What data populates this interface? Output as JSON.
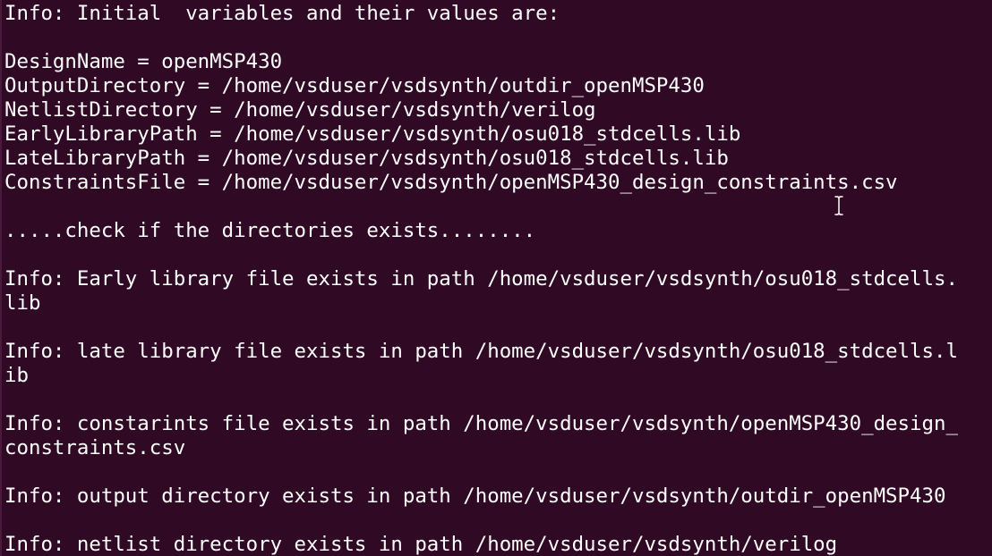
{
  "terminal": {
    "background": "#300a24",
    "foreground": "#ffffff",
    "lines": [
      "Info: Initial  variables and their values are:",
      "",
      "DesignName = openMSP430",
      "OutputDirectory = /home/vsduser/vsdsynth/outdir_openMSP430",
      "NetlistDirectory = /home/vsduser/vsdsynth/verilog",
      "EarlyLibraryPath = /home/vsduser/vsdsynth/osu018_stdcells.lib",
      "LateLibraryPath = /home/vsduser/vsdsynth/osu018_stdcells.lib",
      "ConstraintsFile = /home/vsduser/vsdsynth/openMSP430_design_constraints.csv",
      "",
      ".....check if the directories exists........",
      "",
      "Info: Early library file exists in path /home/vsduser/vsdsynth/osu018_stdcells.",
      "lib",
      "",
      "Info: late library file exists in path /home/vsduser/vsdsynth/osu018_stdcells.l",
      "ib",
      "",
      "Info: constarints file exists in path /home/vsduser/vsdsynth/openMSP430_design_",
      "constraints.csv",
      "",
      "Info: output directory exists in path /home/vsduser/vsdsynth/outdir_openMSP430",
      "",
      "Info: netlist directory exists in path /home/vsduser/vsdsynth/verilog"
    ]
  },
  "cursor": {
    "icon": "text-cursor-ibeam-icon"
  }
}
